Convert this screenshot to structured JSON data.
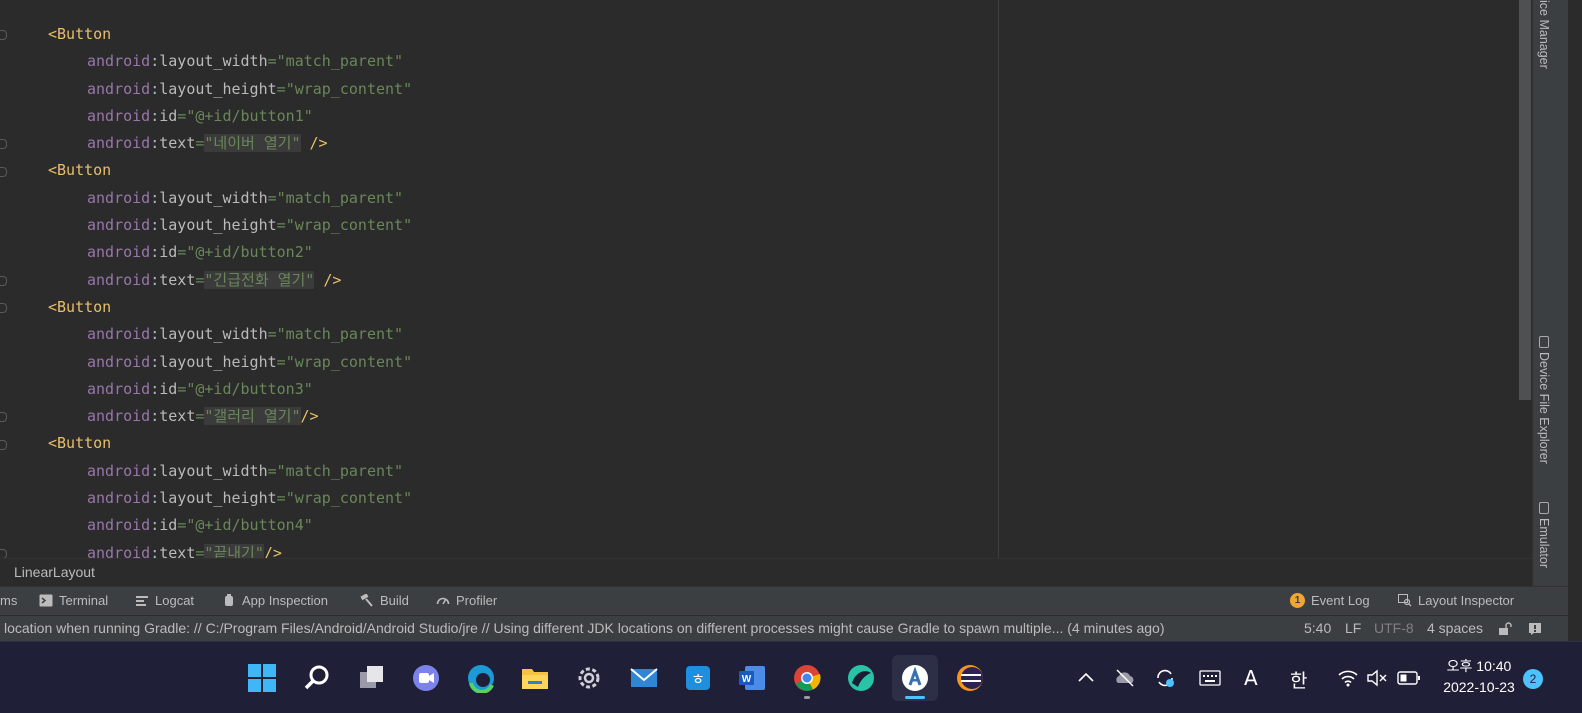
{
  "editor": {
    "lines": [
      {
        "indent": 1,
        "type": "tag",
        "text": "<Button"
      },
      {
        "indent": 2,
        "type": "attr",
        "attr": "layout_width",
        "value": "\"match_parent\""
      },
      {
        "indent": 2,
        "type": "attr",
        "attr": "layout_height",
        "value": "\"wrap_content\""
      },
      {
        "indent": 2,
        "type": "attr",
        "attr": "id",
        "value": "\"@+id/button1\""
      },
      {
        "indent": 2,
        "type": "attr",
        "attr": "text",
        "value": "\"네이버 열기\"",
        "highlight": true,
        "close": " />"
      },
      {
        "indent": 1,
        "type": "tag",
        "text": "<Button"
      },
      {
        "indent": 2,
        "type": "attr",
        "attr": "layout_width",
        "value": "\"match_parent\""
      },
      {
        "indent": 2,
        "type": "attr",
        "attr": "layout_height",
        "value": "\"wrap_content\""
      },
      {
        "indent": 2,
        "type": "attr",
        "attr": "id",
        "value": "\"@+id/button2\""
      },
      {
        "indent": 2,
        "type": "attr",
        "attr": "text",
        "value": "\"긴급전화 열기\"",
        "highlight": true,
        "close": " />"
      },
      {
        "indent": 1,
        "type": "tag",
        "text": "<Button"
      },
      {
        "indent": 2,
        "type": "attr",
        "attr": "layout_width",
        "value": "\"match_parent\""
      },
      {
        "indent": 2,
        "type": "attr",
        "attr": "layout_height",
        "value": "\"wrap_content\""
      },
      {
        "indent": 2,
        "type": "attr",
        "attr": "id",
        "value": "\"@+id/button3\""
      },
      {
        "indent": 2,
        "type": "attr",
        "attr": "text",
        "value": "\"갤러리 열기\"",
        "highlight": true,
        "close": "/>"
      },
      {
        "indent": 1,
        "type": "tag",
        "text": "<Button"
      },
      {
        "indent": 2,
        "type": "attr",
        "attr": "layout_width",
        "value": "\"match_parent\""
      },
      {
        "indent": 2,
        "type": "attr",
        "attr": "layout_height",
        "value": "\"wrap_content\""
      },
      {
        "indent": 2,
        "type": "attr",
        "attr": "id",
        "value": "\"@+id/button4\""
      },
      {
        "indent": 2,
        "type": "attr",
        "attr": "text",
        "value": "\"끝내기\"",
        "highlight": true,
        "close": "/>"
      }
    ],
    "namespace": "android"
  },
  "right_strip": {
    "tabs": [
      {
        "label": "ice Manager",
        "icon": "device-manager-icon"
      },
      {
        "label": "Device File Explorer",
        "icon": "phone-icon"
      },
      {
        "label": "Emulator",
        "icon": "emulator-icon"
      }
    ]
  },
  "breadcrumb": {
    "label": "LinearLayout"
  },
  "tool_windows": {
    "left": [
      {
        "label": "ms",
        "icon": ""
      },
      {
        "label": "Terminal",
        "icon": "terminal-icon"
      },
      {
        "label": "Logcat",
        "icon": "logcat-icon"
      },
      {
        "label": "App Inspection",
        "icon": "app-inspection-icon"
      },
      {
        "label": "Build",
        "icon": "hammer-icon"
      },
      {
        "label": "Profiler",
        "icon": "gauge-icon"
      }
    ],
    "right": [
      {
        "label": "Event Log",
        "icon": "event-log-icon",
        "badge": "1"
      },
      {
        "label": "Layout Inspector",
        "icon": "layout-inspector-icon"
      }
    ]
  },
  "status_bar": {
    "message": " location when running Gradle: // C:/Program Files/Android/Android Studio/jre // Using different JDK locations on different processes might cause Gradle to spawn multiple... (4 minutes ago)",
    "position": "5:40",
    "line_separator": "LF",
    "encoding": "UTF-8",
    "indent": "4 spaces"
  },
  "taskbar": {
    "apps": [
      "windows-start-icon",
      "search-icon",
      "task-view-icon",
      "chat-icon",
      "edge-icon",
      "file-explorer-icon",
      "settings-icon",
      "mail-icon",
      "hancom-icon",
      "word-icon",
      "chrome-icon",
      "android-studio-bird-icon",
      "android-studio-icon",
      "eclipse-icon"
    ],
    "tray": {
      "ime_letter": "A",
      "ime_lang": "한"
    },
    "clock": {
      "time": "오후 10:40",
      "date": "2022-10-23"
    },
    "notifications": "2"
  },
  "colors": {
    "editor_bg": "#2b2b2b",
    "tag": "#e8bf6a",
    "namespace": "#9876aa",
    "value": "#6a8759",
    "taskbar_bg": "#1f2037",
    "accent": "#4cc2ff"
  }
}
